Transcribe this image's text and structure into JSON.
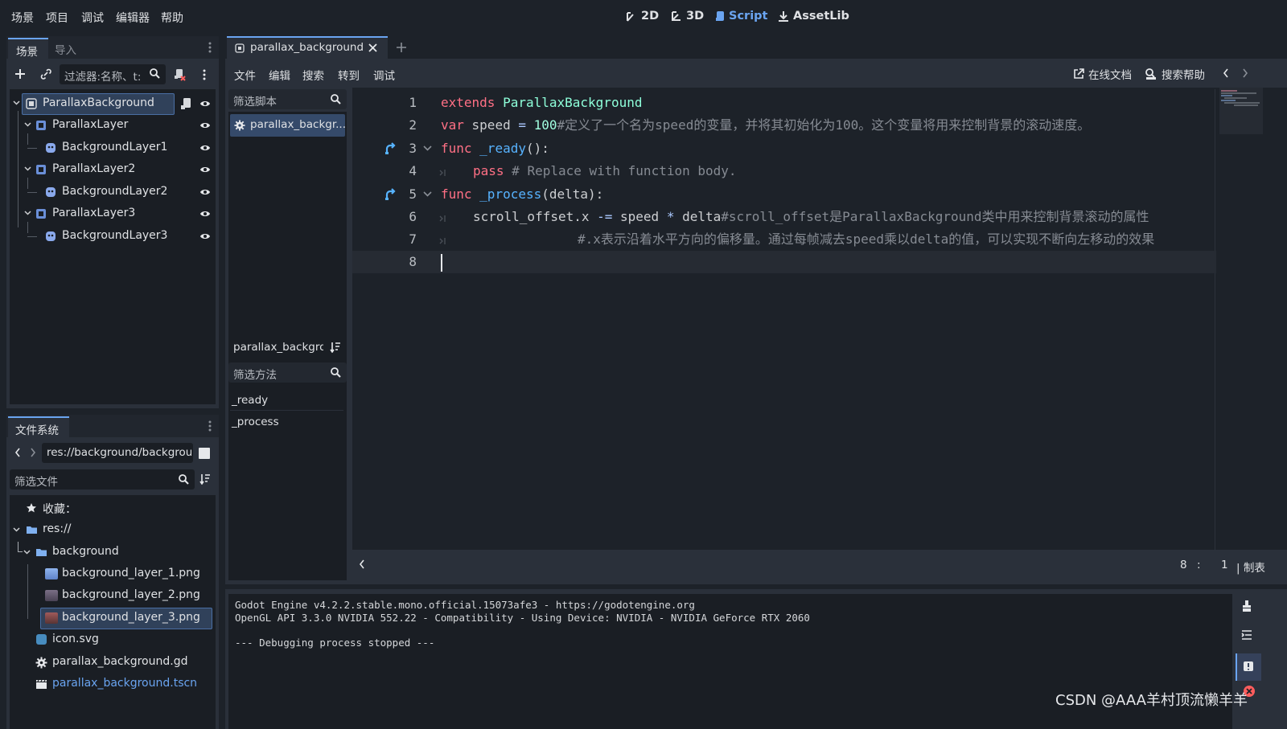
{
  "menu": {
    "items": [
      "场景",
      "项目",
      "调试",
      "编辑器",
      "帮助"
    ]
  },
  "modes": {
    "2d": "2D",
    "3d": "3D",
    "script": "Script",
    "assetlib": "AssetLib"
  },
  "scene_dock": {
    "tab_scene": "场景",
    "tab_import": "导入",
    "filter_placeholder": "过滤器:名称、t:",
    "nodes": [
      {
        "label": "ParallaxBackground",
        "icon": "parallax-background-icon"
      },
      {
        "label": "ParallaxLayer",
        "icon": "parallax-layer-icon"
      },
      {
        "label": "BackgroundLayer1",
        "icon": "sprite-icon"
      },
      {
        "label": "ParallaxLayer2",
        "icon": "parallax-layer-icon"
      },
      {
        "label": "BackgroundLayer2",
        "icon": "sprite-icon"
      },
      {
        "label": "ParallaxLayer3",
        "icon": "parallax-layer-icon"
      },
      {
        "label": "BackgroundLayer3",
        "icon": "sprite-icon"
      }
    ]
  },
  "filesystem": {
    "tab": "文件系统",
    "path": "res://background/backgrou",
    "filter_placeholder": "筛选文件",
    "favorites": "收藏：",
    "items": [
      {
        "label": "res://"
      },
      {
        "label": "background"
      },
      {
        "label": "background_layer_1.png"
      },
      {
        "label": "background_layer_2.png"
      },
      {
        "label": "background_layer_3.png"
      },
      {
        "label": "icon.svg"
      },
      {
        "label": "parallax_background.gd"
      },
      {
        "label": "parallax_background.tscn"
      }
    ]
  },
  "script_editor": {
    "tab_label": "parallax_background",
    "menus": [
      "文件",
      "编辑",
      "搜索",
      "转到",
      "调试"
    ],
    "online_docs": "在线文档",
    "search_help": "搜索帮助",
    "filter_scripts_placeholder": "筛选脚本",
    "script_list": [
      "parallax_backgr..."
    ],
    "current_script": "parallax_backgro",
    "filter_methods_placeholder": "筛选方法",
    "methods": [
      "_ready",
      "_process"
    ],
    "cursor_line": "8",
    "cursor_col": "1",
    "status_sep": ":",
    "status_extra": "| 制表"
  },
  "code": {
    "line_numbers": [
      "1",
      "2",
      "3",
      "4",
      "5",
      "6",
      "7",
      "8"
    ],
    "l1_kw": "extends",
    "l1_cls": "ParallaxBackground",
    "l2_kw": "var",
    "l2_txt": " speed ",
    "l2_op": "=",
    "l2_num": "100",
    "l2_cmt": "#定义了一个名为speed的变量，并将其初始化为100。这个变量将用来控制背景的滚动速度。",
    "l3_kw": "func",
    "l3_fn": "_ready",
    "l3_txt": "():",
    "l4_kw": "pass",
    "l4_cmt": "# Replace with function body.",
    "l5_kw": "func",
    "l5_fn": "_process",
    "l5_txt": "(delta):",
    "l6_a": "scroll_offset.x ",
    "l6_op1": "-=",
    "l6_b": " speed ",
    "l6_op2": "*",
    "l6_c": " delta",
    "l6_cmt": "#scroll_offset是ParallaxBackground类中用来控制背景滚动的属性",
    "l7_cmt": "#.x表示沿着水平方向的偏移量。通过每帧减去speed乘以delta的值，可以实现不断向左移动的效果"
  },
  "console": {
    "lines": [
      "Godot Engine v4.2.2.stable.mono.official.15073afe3 - https://godotengine.org",
      "OpenGL API 3.3.0 NVIDIA 552.22 - Compatibility - Using Device: NVIDIA - NVIDIA GeForce RTX 2060",
      "",
      "--- Debugging process stopped ---"
    ]
  },
  "watermark": "CSDN @AAA羊村顶流懒羊羊",
  "colors": {
    "accent": "#6aa4f0",
    "keyword": "#ff7085",
    "class": "#8effda",
    "function": "#57b3ff",
    "comment": "#868b93"
  }
}
